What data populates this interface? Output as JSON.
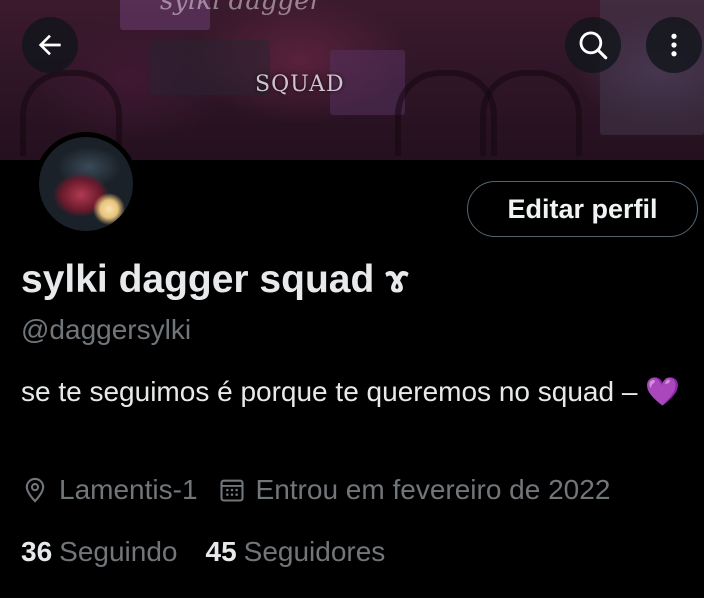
{
  "banner": {
    "squad_text": "SQUAD",
    "title_text": "sylki dagger"
  },
  "header": {
    "back_icon": "arrow-left-icon",
    "search_icon": "search-icon",
    "more_icon": "more-vertical-icon"
  },
  "profile": {
    "edit_button_label": "Editar perfil",
    "display_name": "sylki dagger squad ɤ",
    "handle": "@daggersylki",
    "bio_text": "se te seguimos é porque te queremos no squad – ",
    "bio_emoji": "💜",
    "location": "Lamentis-1",
    "joined": "Entrou em fevereiro de 2022",
    "following_count": "36",
    "following_label": "Seguindo",
    "followers_count": "45",
    "followers_label": "Seguidores"
  },
  "colors": {
    "background": "#000000",
    "text_primary": "#e7e9ea",
    "text_secondary": "#71767b",
    "button_border": "#536471",
    "heart": "#aa8ed6"
  }
}
